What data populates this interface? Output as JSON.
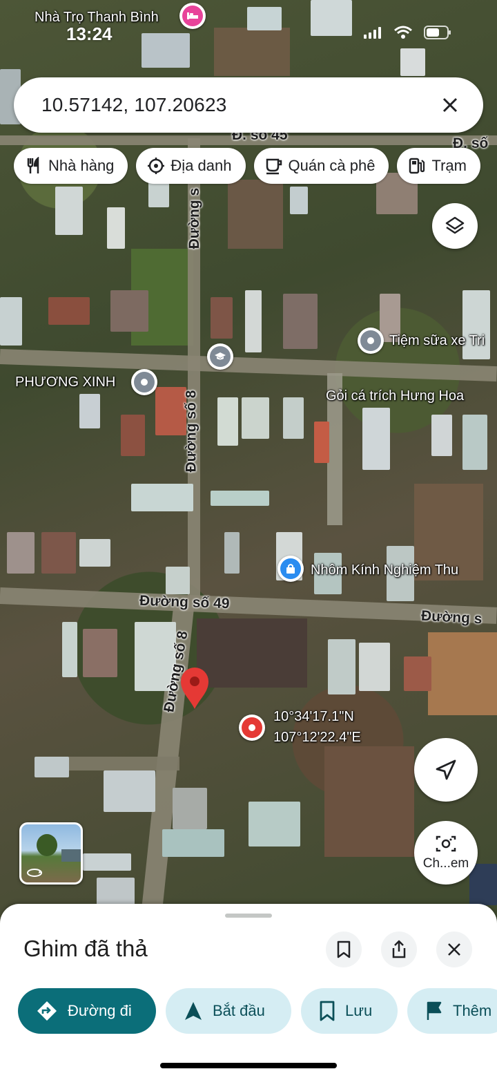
{
  "status_bar": {
    "time": "13:24"
  },
  "search": {
    "query": "10.57142, 107.20623"
  },
  "chips": [
    {
      "label": "Nhà hàng",
      "icon": "restaurant-icon"
    },
    {
      "label": "Địa danh",
      "icon": "landmark-icon"
    },
    {
      "label": "Quán cà phê",
      "icon": "coffee-icon"
    },
    {
      "label": "Trạm",
      "icon": "gas-station-icon"
    }
  ],
  "map": {
    "labels": {
      "hotel": "Nhà Trọ Thanh Bình",
      "shop_milk": "Tiệm sữa xe Tri",
      "phuong_xinh": "PHƯƠNG XINH",
      "goi_ca": "Gỏi cá trích Hưng Hoa",
      "nhom_kinh": "Nhôm Kính Nghiệm Thu",
      "coordinates_lat": "10°34'17.1\"N",
      "coordinates_lng": "107°12'22.4\"E"
    },
    "roads": {
      "road_45": "Đ. số 45",
      "road_so": "Đ. số",
      "road_s_top": "Đường s",
      "road_8_mid": "Đường số 8",
      "road_49": "Đường số 49",
      "road_so_right": "Đường s",
      "road_8_bottom": "Đường số 8"
    }
  },
  "controls": {
    "camera_label": "Ch...em"
  },
  "sheet": {
    "title": "Ghim đã thả",
    "actions": [
      {
        "label": "Đường đi",
        "icon": "directions-icon"
      },
      {
        "label": "Bắt đầu",
        "icon": "navigation-arrow-icon"
      },
      {
        "label": "Lưu",
        "icon": "bookmark-icon"
      },
      {
        "label": "Thêm",
        "icon": "flag-icon"
      }
    ]
  },
  "colors": {
    "primary": "#0b6e79",
    "secondary_bg": "#d5edf3",
    "pin_red": "#e53935",
    "hotel_pink": "#e8439a",
    "poi_blue": "#2a8cf0"
  }
}
